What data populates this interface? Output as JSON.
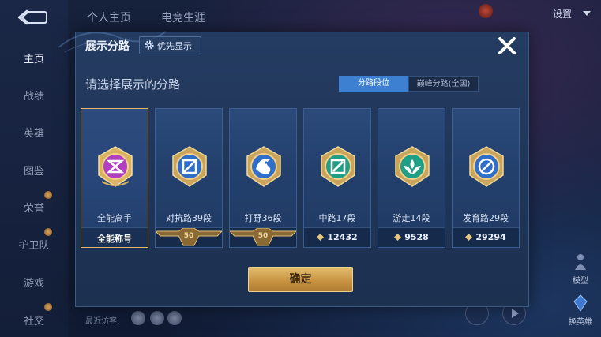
{
  "background": {
    "left_nav": [
      "主页",
      "战绩",
      "英雄",
      "图鉴",
      "荣誉",
      "护卫队",
      "游戏",
      "社交"
    ],
    "top_tabs": [
      "个人主页",
      "电竞生涯"
    ],
    "settings_label": "设置",
    "right_widgets": [
      "模型",
      "换英雄"
    ],
    "recent_visitors_label": "最近访客:"
  },
  "dialog": {
    "title": "展示分路",
    "priority_button": "优先显示",
    "subtitle": "请选择展示的分路",
    "segments": [
      "分路段位",
      "巅峰分路(全国)"
    ],
    "active_segment": "分路段位",
    "cards": [
      {
        "label": "全能高手",
        "footer_type": "title",
        "footer": "全能称号",
        "icon": "all-round-badge-icon",
        "selected": true
      },
      {
        "label": "对抗路39段",
        "footer_type": "rank",
        "footer": "50",
        "icon": "clash-lane-badge-icon",
        "selected": false
      },
      {
        "label": "打野36段",
        "footer_type": "rank",
        "footer": "50",
        "icon": "jungle-badge-icon",
        "selected": false
      },
      {
        "label": "中路17段",
        "footer_type": "points",
        "footer": "12432",
        "icon": "mid-lane-badge-icon",
        "selected": false
      },
      {
        "label": "游走14段",
        "footer_type": "points",
        "footer": "9528",
        "icon": "roam-badge-icon",
        "selected": false
      },
      {
        "label": "发育路29段",
        "footer_type": "points",
        "footer": "29294",
        "icon": "farm-lane-badge-icon",
        "selected": false
      }
    ],
    "confirm_button": "确定"
  },
  "colors": {
    "accent_blue": "#3d7fd0",
    "gold": "#e1b86a",
    "dialog_bg": "#223a60"
  }
}
